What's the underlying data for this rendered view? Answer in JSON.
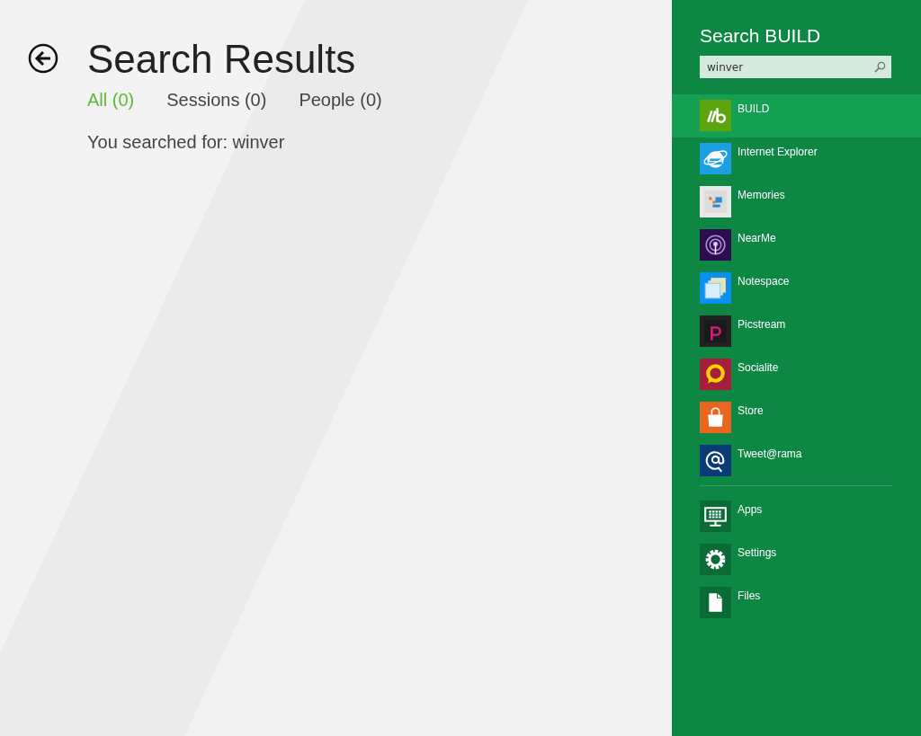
{
  "header": {
    "title": "Search Results"
  },
  "tabs": [
    {
      "label": "All (0)",
      "selected": true
    },
    {
      "label": "Sessions (0)",
      "selected": false
    },
    {
      "label": "People (0)",
      "selected": false
    }
  ],
  "query_summary": "You searched for: winver",
  "search_pane": {
    "title": "Search BUILD",
    "query": "winver",
    "apps": [
      {
        "name": "BUILD",
        "kind": "build",
        "color": "#5da40f",
        "selected": true
      },
      {
        "name": "Internet Explorer",
        "kind": "browser",
        "color": "#1ba1e2",
        "selected": false
      },
      {
        "name": "Memories",
        "kind": "memories",
        "color": "#e8e8e8",
        "selected": false
      },
      {
        "name": "NearMe",
        "kind": "nearme",
        "color": "#2b0f4d",
        "selected": false
      },
      {
        "name": "Notespace",
        "kind": "notes",
        "color": "#0b8ff0",
        "selected": false
      },
      {
        "name": "Picstream",
        "kind": "picstream",
        "color": "#222222",
        "selected": false
      },
      {
        "name": "Socialite",
        "kind": "socialite",
        "color": "#a71e3b",
        "selected": false
      },
      {
        "name": "Store",
        "kind": "store",
        "color": "#e8661f",
        "selected": false
      },
      {
        "name": "Tweet@rama",
        "kind": "tweet",
        "color": "#0a3a78",
        "selected": false
      }
    ],
    "places": [
      {
        "name": "Apps",
        "kind": "apps"
      },
      {
        "name": "Settings",
        "kind": "settings"
      },
      {
        "name": "Files",
        "kind": "files"
      }
    ]
  }
}
